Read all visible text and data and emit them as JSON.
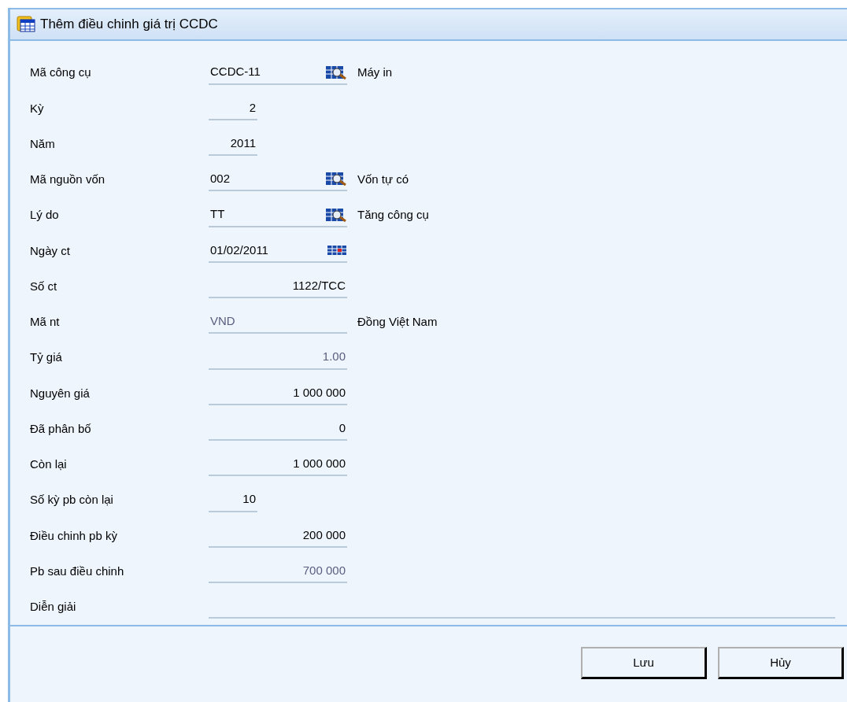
{
  "window": {
    "title": "Thêm điều chinh giá trị CCDC"
  },
  "fields": [
    {
      "label": "Mã công cụ",
      "kind": "lookup",
      "value": "CCDC-11",
      "disabled": false,
      "note": "Máy in"
    },
    {
      "label": "Kỳ",
      "kind": "short",
      "value": "2",
      "disabled": false
    },
    {
      "label": "Năm",
      "kind": "short",
      "value": "2011",
      "disabled": false
    },
    {
      "label": "Mã nguồn vốn",
      "kind": "lookup",
      "value": "002",
      "disabled": false,
      "note": "Vốn tự có"
    },
    {
      "label": "Lý do",
      "kind": "lookup",
      "value": "TT",
      "disabled": false,
      "note": "Tăng công cụ"
    },
    {
      "label": "Ngày ct",
      "kind": "date",
      "value": "01/02/2011",
      "disabled": false
    },
    {
      "label": "Số ct",
      "kind": "number",
      "value": "1122/TCC",
      "disabled": false
    },
    {
      "label": "Mã nt",
      "kind": "text",
      "value": "VND",
      "disabled": true,
      "note": "Đồng Việt Nam"
    },
    {
      "label": "Tỷ giá",
      "kind": "number",
      "value": "1.00",
      "disabled": true
    },
    {
      "label": "Nguyên giá",
      "kind": "number",
      "value": "1 000 000",
      "disabled": false
    },
    {
      "label": "Đã phân bố",
      "kind": "number",
      "value": "0",
      "disabled": false
    },
    {
      "label": "Còn lại",
      "kind": "number",
      "value": "1 000 000",
      "disabled": false
    },
    {
      "label": "Số kỳ pb còn lại",
      "kind": "short",
      "value": "10",
      "disabled": false
    },
    {
      "label": "Điều chinh pb kỳ",
      "kind": "number",
      "value": "200 000",
      "disabled": false
    },
    {
      "label": "Pb sau điều chinh",
      "kind": "number",
      "value": "700 000",
      "disabled": true
    },
    {
      "label": "Diễn giải",
      "kind": "memo"
    }
  ],
  "buttons": [
    "Lưu",
    "Hủy"
  ]
}
